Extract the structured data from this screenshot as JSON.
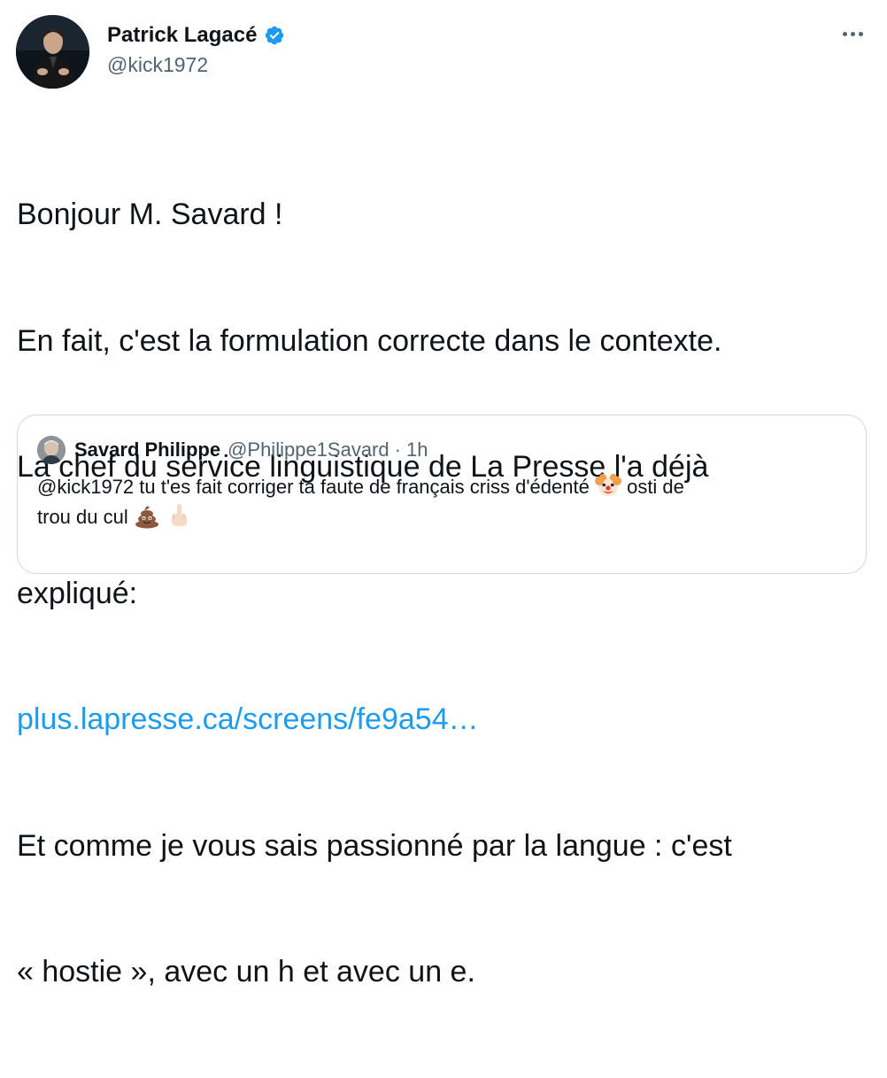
{
  "tweet": {
    "author": {
      "name": "Patrick Lagacé",
      "handle": "@kick1972",
      "verified": true
    },
    "text_lines": [
      "Bonjour M. Savard !",
      "En fait, c'est la formulation correcte dans le contexte.",
      "La chef du service linguistique de La Presse l'a déjà",
      "expliqué:"
    ],
    "link": "plus.lapresse.ca/screens/fe9a54…",
    "text_lines_after": [
      "Et comme je vous sais passionné par la langue : c'est",
      "« hostie », avec un h et avec un e."
    ]
  },
  "quote": {
    "author": {
      "name": "Savard Philippe",
      "handle": "@Philippe1Savard",
      "separator": "·",
      "time": "1h"
    },
    "text_part1": "@kick1972 tu t'es fait corriger ta faute de français criss d'édenté",
    "text_part2": "osti de",
    "text_line2": "trou du cul",
    "emojis": [
      "clown-face",
      "pile-of-poo",
      "middle-finger"
    ]
  },
  "colors": {
    "text_primary": "#0f1419",
    "text_secondary": "#536471",
    "link": "#1d9bf0",
    "verified_badge": "#1d9bf0",
    "border": "#cfd9de"
  }
}
